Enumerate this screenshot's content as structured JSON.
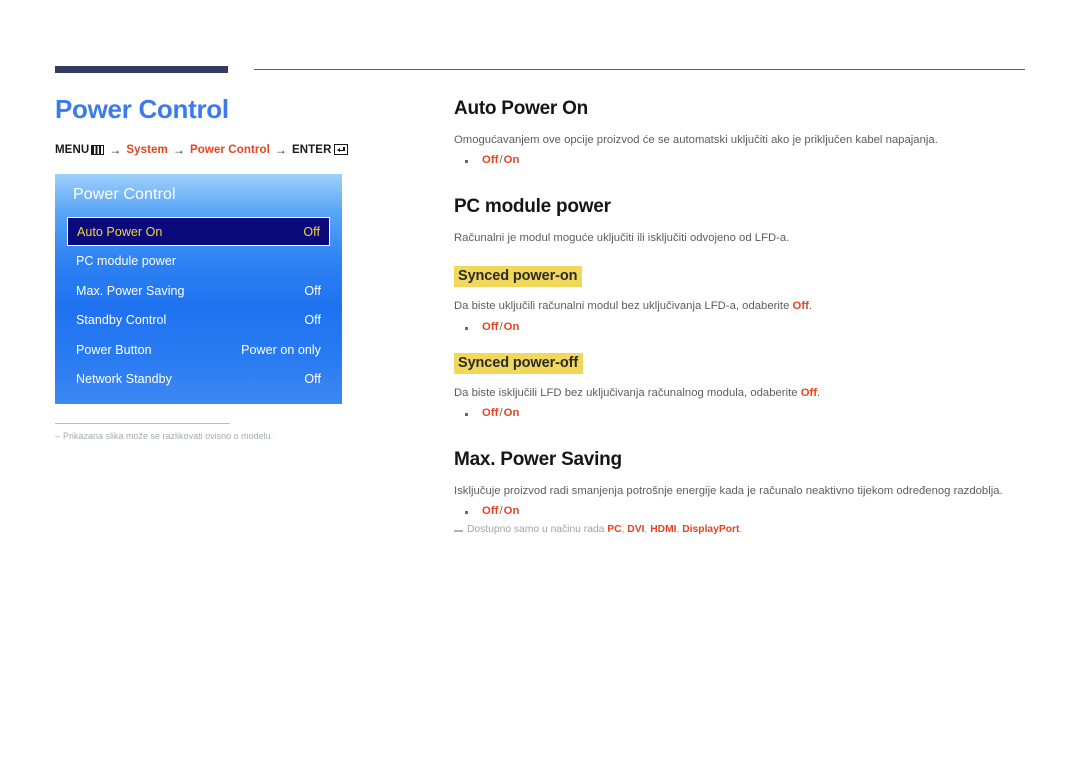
{
  "theme": {
    "accent_blue": "#3d7bec",
    "accent_red": "#e8431f",
    "highlight_yellow": "#f2d85a",
    "rule_navy": "#353b5e",
    "osd_selected_bg": "#0a0a7a",
    "osd_selected_text": "#f5d33c"
  },
  "left": {
    "page_title": "Power Control",
    "breadcrumb": {
      "menu_label": "MENU",
      "menu_icon": "menu-bars-icon",
      "arrow": "→",
      "crumb1": "System",
      "crumb2": "Power Control",
      "enter_label": "ENTER",
      "enter_icon": "enter-return-icon"
    },
    "osd": {
      "title": "Power Control",
      "rows": [
        {
          "label": "Auto Power On",
          "value": "Off",
          "selected": true
        },
        {
          "label": "PC module power",
          "value": "",
          "selected": false
        },
        {
          "label": "Max. Power Saving",
          "value": "Off",
          "selected": false
        },
        {
          "label": "Standby Control",
          "value": "Off",
          "selected": false
        },
        {
          "label": "Power Button",
          "value": "Power on only",
          "selected": false
        },
        {
          "label": "Network Standby",
          "value": "Off",
          "selected": false
        }
      ]
    },
    "footnote": {
      "dash": "–",
      "text": "Prikazana slika može se razlikovati ovisno o modelu."
    }
  },
  "right": {
    "sections": [
      {
        "title": "Auto Power On",
        "body_pre": "Omogućavanjem ove opcije proizvod će se automatski uključiti ako je priključen kabel napajanja.",
        "bullet_off": "Off",
        "bullet_slash": "/",
        "bullet_on": "On"
      },
      {
        "title": "PC module power",
        "body_pre": "Računalni je modul moguće uključiti ili isključiti odvojeno od LFD-a."
      }
    ],
    "synced_on": {
      "heading": "Synced power-on",
      "body_pre": "Da biste uključili računalni modul bez uključivanja LFD-a, odaberite ",
      "body_em": "Off",
      "body_post": ".",
      "bullet_off": "Off",
      "bullet_slash": "/",
      "bullet_on": "On"
    },
    "synced_off": {
      "heading": "Synced power-off",
      "body_pre": "Da biste isključili LFD bez uključivanja računalnog modula, odaberite ",
      "body_em": "Off",
      "body_post": ".",
      "bullet_off": "Off",
      "bullet_slash": "/",
      "bullet_on": "On"
    },
    "max_power_saving": {
      "title": "Max. Power Saving",
      "body": "Isključuje proizvod radi smanjenja potrošnje energije kada je računalo neaktivno tijekom određenog razdoblja.",
      "bullet_off": "Off",
      "bullet_slash": "/",
      "bullet_on": "On",
      "note_pre": "Dostupno samo u načinu rada ",
      "note_modes": [
        "PC",
        "DVI",
        "HDMI",
        "DisplayPort"
      ],
      "note_sep": ", ",
      "note_post": "."
    }
  }
}
